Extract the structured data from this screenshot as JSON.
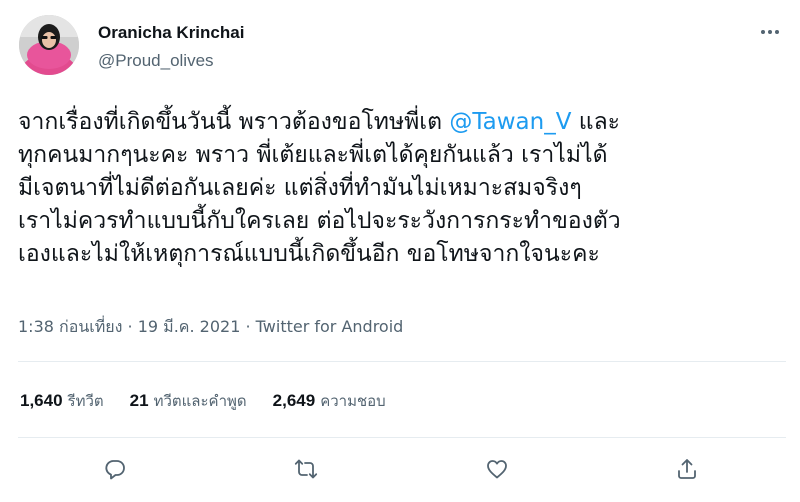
{
  "author": {
    "display_name": "Oranicha Krinchai",
    "handle": "@Proud_olives"
  },
  "tweet": {
    "lines": [
      {
        "before": "จากเรื่องที่เกิดขึ้นวันนี้ พราวต้องขอโทษพี่เต ",
        "mention": "@Tawan_V",
        "after": " และ"
      },
      {
        "text": "ทุกคนมากๆนะคะ พราว พี่เต้ยและพี่เตได้คุยกันแล้ว เราไม่ได้"
      },
      {
        "text": "มีเจตนาที่ไม่ดีต่อกันเลยค่ะ แต่สิ่งที่ทำมันไม่เหมาะสมจริงๆ"
      },
      {
        "text": "เราไม่ควรทำแบบนี้กับใครเลย ต่อไปจะระวังการกระทำของตัว"
      },
      {
        "text": "เองและไม่ให้เหตุการณ์แบบนี้เกิดขึ้นอีก ขอโทษจากใจนะคะ"
      }
    ]
  },
  "meta": {
    "time": "1:38 ก่อนเที่ยง",
    "separator1": " · ",
    "date": "19 มี.ค. 2021",
    "separator2": " · ",
    "source": "Twitter for Android"
  },
  "stats": {
    "retweets": {
      "count": "1,640",
      "label": "รีทวีต"
    },
    "quotes": {
      "count": "21",
      "label": "ทวีตและคำพูด"
    },
    "likes": {
      "count": "2,649",
      "label": "ความชอบ"
    }
  },
  "icons": {
    "more": "more-icon",
    "reply": "reply-icon",
    "retweet": "retweet-icon",
    "like": "like-icon",
    "share": "share-icon"
  },
  "colors": {
    "mention": "#1d9bf0",
    "secondary_text": "#536471",
    "primary_text": "#0f1419",
    "divider": "#e6ecf0"
  }
}
